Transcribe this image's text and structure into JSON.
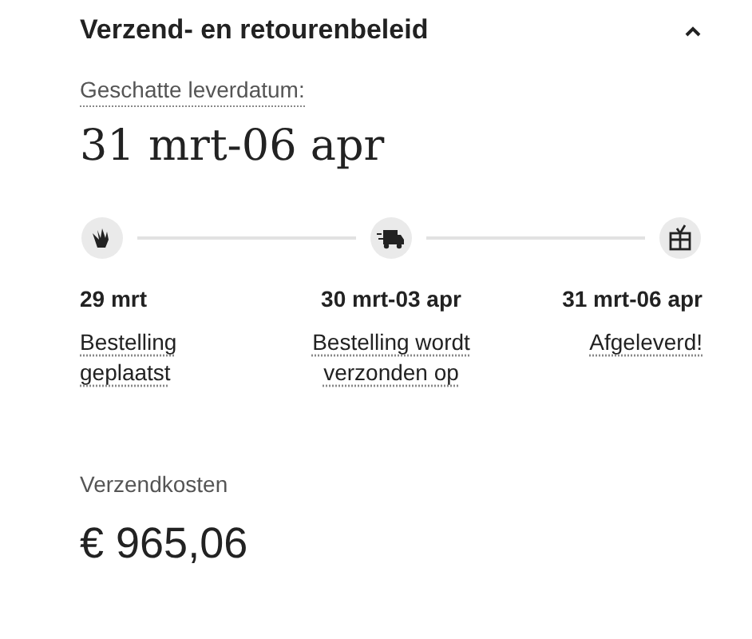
{
  "section": {
    "title": "Verzend- en retourenbeleid",
    "expanded": true
  },
  "estimate": {
    "label": "Geschatte leverdatum:",
    "value": "31 mrt-06 apr"
  },
  "steps": [
    {
      "kind": "ordered",
      "date": "29 mrt",
      "label": "Bestelling geplaatst"
    },
    {
      "kind": "shipped",
      "date": "30 mrt-03 apr",
      "label": "Bestelling wordt verzonden op"
    },
    {
      "kind": "delivered",
      "date": "31 mrt-06 apr",
      "label": "Afgeleverd!"
    }
  ],
  "shipping": {
    "label": "Verzendkosten",
    "value": "€ 965,06"
  }
}
